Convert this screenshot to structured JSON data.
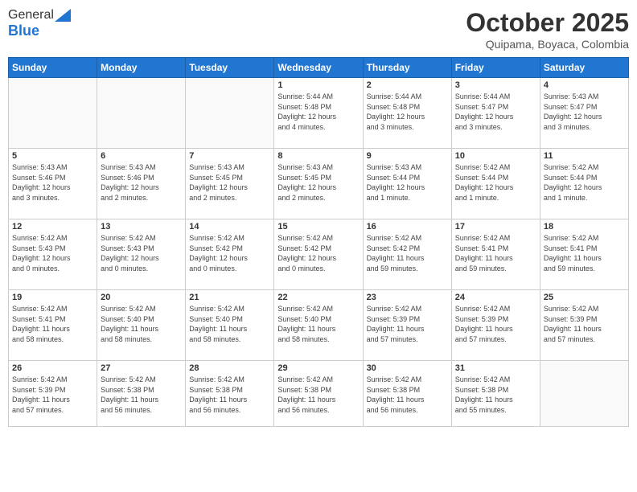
{
  "header": {
    "logo_general": "General",
    "logo_blue": "Blue",
    "month_title": "October 2025",
    "subtitle": "Quipama, Boyaca, Colombia"
  },
  "days_of_week": [
    "Sunday",
    "Monday",
    "Tuesday",
    "Wednesday",
    "Thursday",
    "Friday",
    "Saturday"
  ],
  "weeks": [
    [
      {
        "day": "",
        "info": ""
      },
      {
        "day": "",
        "info": ""
      },
      {
        "day": "",
        "info": ""
      },
      {
        "day": "1",
        "info": "Sunrise: 5:44 AM\nSunset: 5:48 PM\nDaylight: 12 hours\nand 4 minutes."
      },
      {
        "day": "2",
        "info": "Sunrise: 5:44 AM\nSunset: 5:48 PM\nDaylight: 12 hours\nand 3 minutes."
      },
      {
        "day": "3",
        "info": "Sunrise: 5:44 AM\nSunset: 5:47 PM\nDaylight: 12 hours\nand 3 minutes."
      },
      {
        "day": "4",
        "info": "Sunrise: 5:43 AM\nSunset: 5:47 PM\nDaylight: 12 hours\nand 3 minutes."
      }
    ],
    [
      {
        "day": "5",
        "info": "Sunrise: 5:43 AM\nSunset: 5:46 PM\nDaylight: 12 hours\nand 3 minutes."
      },
      {
        "day": "6",
        "info": "Sunrise: 5:43 AM\nSunset: 5:46 PM\nDaylight: 12 hours\nand 2 minutes."
      },
      {
        "day": "7",
        "info": "Sunrise: 5:43 AM\nSunset: 5:45 PM\nDaylight: 12 hours\nand 2 minutes."
      },
      {
        "day": "8",
        "info": "Sunrise: 5:43 AM\nSunset: 5:45 PM\nDaylight: 12 hours\nand 2 minutes."
      },
      {
        "day": "9",
        "info": "Sunrise: 5:43 AM\nSunset: 5:44 PM\nDaylight: 12 hours\nand 1 minute."
      },
      {
        "day": "10",
        "info": "Sunrise: 5:42 AM\nSunset: 5:44 PM\nDaylight: 12 hours\nand 1 minute."
      },
      {
        "day": "11",
        "info": "Sunrise: 5:42 AM\nSunset: 5:44 PM\nDaylight: 12 hours\nand 1 minute."
      }
    ],
    [
      {
        "day": "12",
        "info": "Sunrise: 5:42 AM\nSunset: 5:43 PM\nDaylight: 12 hours\nand 0 minutes."
      },
      {
        "day": "13",
        "info": "Sunrise: 5:42 AM\nSunset: 5:43 PM\nDaylight: 12 hours\nand 0 minutes."
      },
      {
        "day": "14",
        "info": "Sunrise: 5:42 AM\nSunset: 5:42 PM\nDaylight: 12 hours\nand 0 minutes."
      },
      {
        "day": "15",
        "info": "Sunrise: 5:42 AM\nSunset: 5:42 PM\nDaylight: 12 hours\nand 0 minutes."
      },
      {
        "day": "16",
        "info": "Sunrise: 5:42 AM\nSunset: 5:42 PM\nDaylight: 11 hours\nand 59 minutes."
      },
      {
        "day": "17",
        "info": "Sunrise: 5:42 AM\nSunset: 5:41 PM\nDaylight: 11 hours\nand 59 minutes."
      },
      {
        "day": "18",
        "info": "Sunrise: 5:42 AM\nSunset: 5:41 PM\nDaylight: 11 hours\nand 59 minutes."
      }
    ],
    [
      {
        "day": "19",
        "info": "Sunrise: 5:42 AM\nSunset: 5:41 PM\nDaylight: 11 hours\nand 58 minutes."
      },
      {
        "day": "20",
        "info": "Sunrise: 5:42 AM\nSunset: 5:40 PM\nDaylight: 11 hours\nand 58 minutes."
      },
      {
        "day": "21",
        "info": "Sunrise: 5:42 AM\nSunset: 5:40 PM\nDaylight: 11 hours\nand 58 minutes."
      },
      {
        "day": "22",
        "info": "Sunrise: 5:42 AM\nSunset: 5:40 PM\nDaylight: 11 hours\nand 58 minutes."
      },
      {
        "day": "23",
        "info": "Sunrise: 5:42 AM\nSunset: 5:39 PM\nDaylight: 11 hours\nand 57 minutes."
      },
      {
        "day": "24",
        "info": "Sunrise: 5:42 AM\nSunset: 5:39 PM\nDaylight: 11 hours\nand 57 minutes."
      },
      {
        "day": "25",
        "info": "Sunrise: 5:42 AM\nSunset: 5:39 PM\nDaylight: 11 hours\nand 57 minutes."
      }
    ],
    [
      {
        "day": "26",
        "info": "Sunrise: 5:42 AM\nSunset: 5:39 PM\nDaylight: 11 hours\nand 57 minutes."
      },
      {
        "day": "27",
        "info": "Sunrise: 5:42 AM\nSunset: 5:38 PM\nDaylight: 11 hours\nand 56 minutes."
      },
      {
        "day": "28",
        "info": "Sunrise: 5:42 AM\nSunset: 5:38 PM\nDaylight: 11 hours\nand 56 minutes."
      },
      {
        "day": "29",
        "info": "Sunrise: 5:42 AM\nSunset: 5:38 PM\nDaylight: 11 hours\nand 56 minutes."
      },
      {
        "day": "30",
        "info": "Sunrise: 5:42 AM\nSunset: 5:38 PM\nDaylight: 11 hours\nand 56 minutes."
      },
      {
        "day": "31",
        "info": "Sunrise: 5:42 AM\nSunset: 5:38 PM\nDaylight: 11 hours\nand 55 minutes."
      },
      {
        "day": "",
        "info": ""
      }
    ]
  ]
}
